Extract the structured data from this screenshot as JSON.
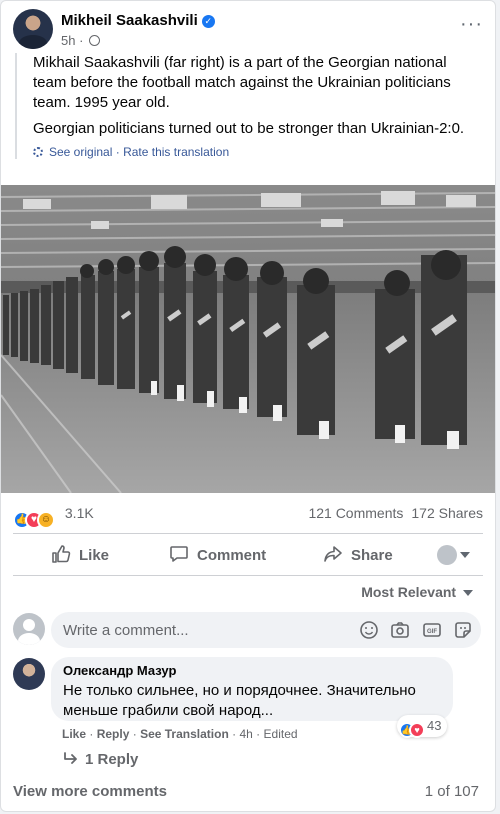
{
  "post": {
    "author": "Mikheil Saakashvili",
    "time": "5h",
    "more": "···",
    "translation": [
      "Mikhail Saakashvili (far right) is a part of the Georgian national team before the football match against the Ukrainian politicians team. 1995 year old.",
      "Georgian politicians turned out to be stronger than Ukrainian-2:0."
    ],
    "see_original": "See original",
    "rate_translation": "Rate this translation",
    "sep": "·"
  },
  "stats": {
    "reaction_count": "3.1K",
    "comments": "121 Comments",
    "shares": "172 Shares",
    "reactions": [
      "like",
      "love",
      "haha"
    ]
  },
  "actions": {
    "like": "Like",
    "comment": "Comment",
    "share": "Share"
  },
  "sort": {
    "label": "Most Relevant"
  },
  "write_comment": {
    "placeholder": "Write a comment..."
  },
  "comment": {
    "author": "Олександр Мазур",
    "text": "Не только сильнее, но и порядочнее. Значительно меньше грабили свой народ...",
    "reaction_count": "43",
    "like": "Like",
    "reply": "Reply",
    "see_translation": "See Translation",
    "time": "4h",
    "edited": "Edited",
    "dot": "·",
    "replies": "1 Reply"
  },
  "footer": {
    "view_more": "View more comments",
    "page_count": "1 of 107"
  },
  "colors": {
    "accent": "#1877f2",
    "link": "#385898",
    "secondary_text": "#65676b"
  }
}
